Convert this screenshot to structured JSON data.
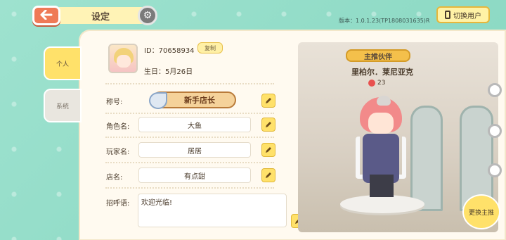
{
  "header": {
    "back_icon": "arrow-left-icon",
    "title": "设定",
    "settings_icon": "gear-icon",
    "version": "版本：1.0.1.23(TP1808031635)R",
    "switch_user": "切换用户"
  },
  "tabs": [
    {
      "label": "个人"
    },
    {
      "label": "系统"
    }
  ],
  "profile": {
    "id_text": "ID：70658934",
    "copy_label": "复制",
    "birthday": "生日：5月26日",
    "title_label": "称号:",
    "title_value": "新手店长",
    "role_label": "角色名:",
    "role_value": "大鱼",
    "player_label": "玩家名:",
    "player_value": "居居",
    "shop_label": "店名:",
    "shop_value": "有点甜",
    "greet_label": "招呼语:",
    "greet_value": "欢迎光临!"
  },
  "partner": {
    "ribbon": "主推伙伴",
    "name": "里柏尔．莱尼亚克",
    "hearts": "23",
    "change_button": "更换主推"
  },
  "colors": {
    "accent": "#ffe16a",
    "back_button": "#ef7a57",
    "background": "#8fdcc6"
  }
}
